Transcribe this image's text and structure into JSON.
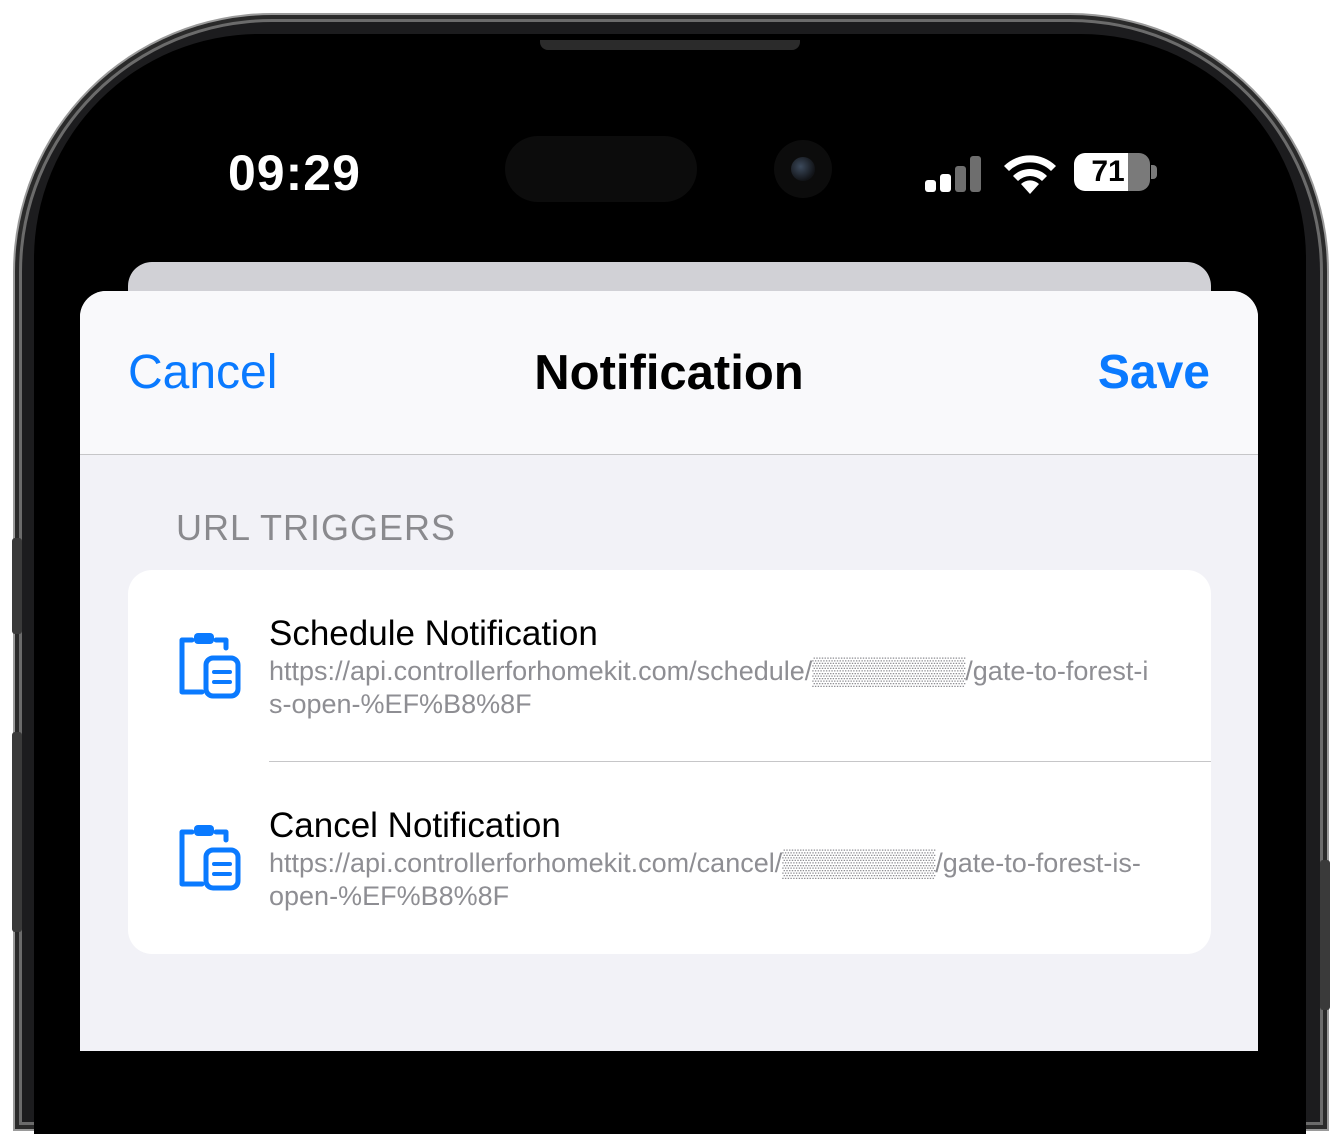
{
  "status_bar": {
    "time": "09:29",
    "battery_level": "71",
    "battery_fraction": 0.71,
    "signal_bars_active": 2,
    "signal_bars_total": 4
  },
  "nav": {
    "cancel_label": "Cancel",
    "title": "Notification",
    "save_label": "Save"
  },
  "section": {
    "header": "URL TRIGGERS"
  },
  "triggers": [
    {
      "title": "Schedule Notification",
      "url": "https://api.controllerforhomekit.com/schedule/▒▒▒▒▒▒▒▒/gate-to-forest-is-open-%EF%B8%8F",
      "icon": "clipboard-icon"
    },
    {
      "title": "Cancel Notification",
      "url": "https://api.controllerforhomekit.com/cancel/▒▒▒▒▒▒▒▒/gate-to-forest-is-open-%EF%B8%8F",
      "icon": "clipboard-icon"
    }
  ],
  "colors": {
    "accent": "#0a7aff",
    "background": "#f2f2f7",
    "secondary_text": "#8e8e93"
  }
}
